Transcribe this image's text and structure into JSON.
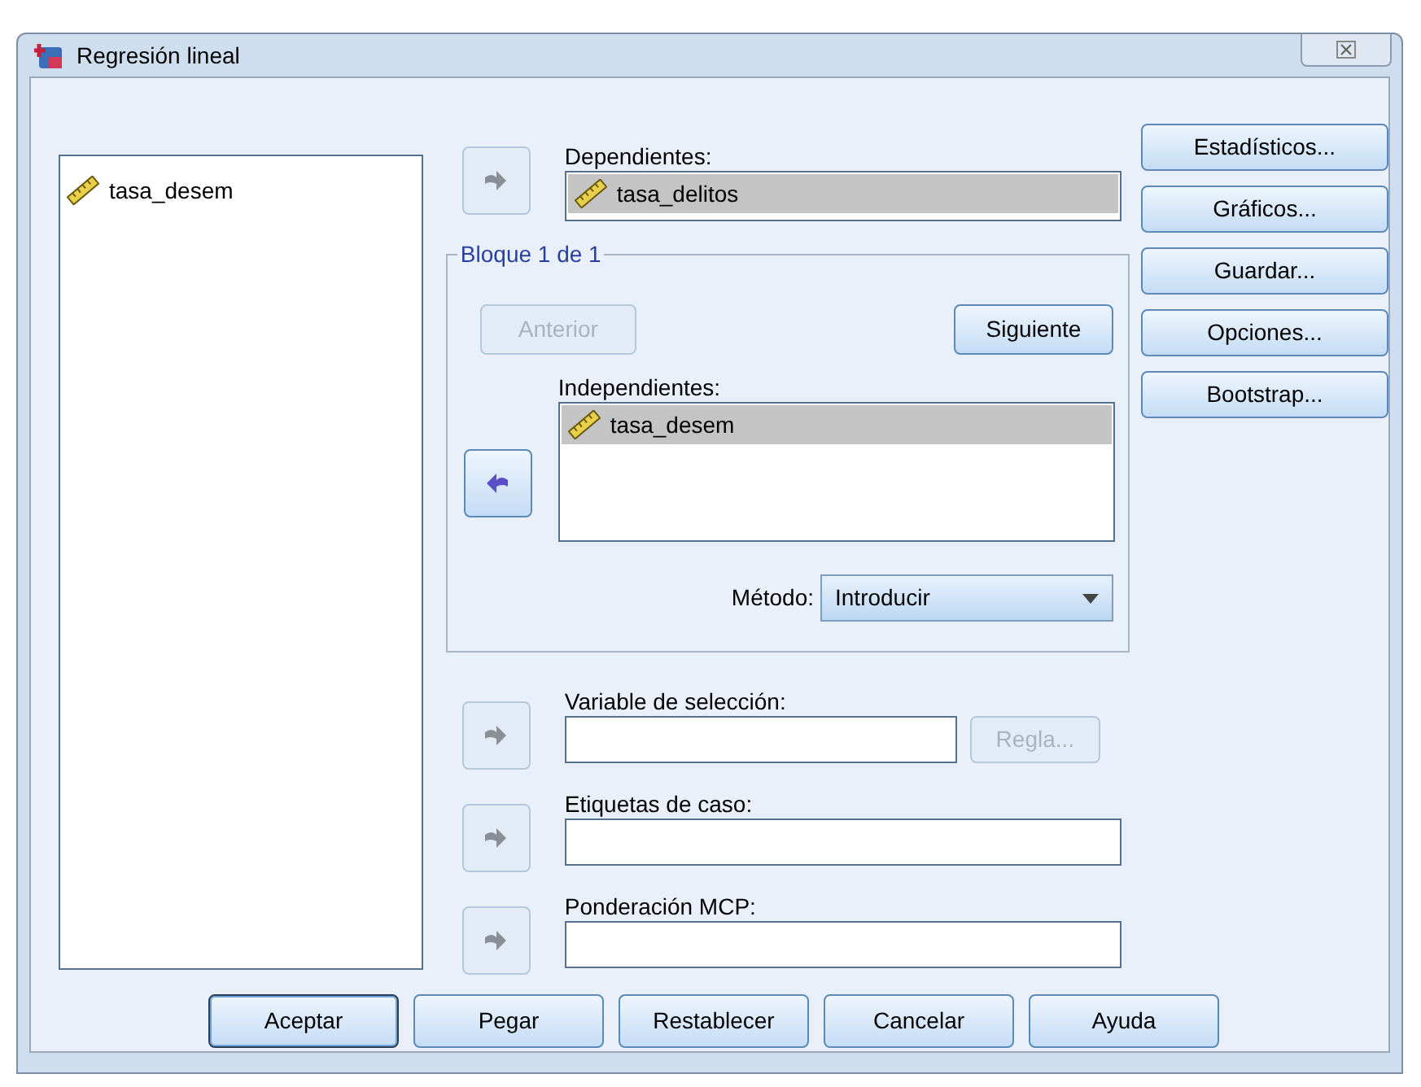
{
  "window": {
    "title": "Regresión lineal"
  },
  "variables": [
    {
      "name": "tasa_desem",
      "selected": false
    }
  ],
  "dependent": {
    "label": "Dependientes:",
    "arrow": {
      "kind": "right",
      "disabled": true
    },
    "items": [
      {
        "name": "tasa_delitos",
        "selected": true
      }
    ]
  },
  "block": {
    "title": "Bloque 1 de 1",
    "previous": {
      "label": "Anterior",
      "disabled": true
    },
    "next": {
      "label": "Siguiente",
      "disabled": false
    },
    "independent": {
      "label": "Independientes:",
      "arrow": {
        "kind": "left",
        "disabled": false
      },
      "items": [
        {
          "name": "tasa_desem",
          "selected": true
        }
      ]
    },
    "method": {
      "label": "Método:",
      "value": "Introducir"
    }
  },
  "selection": {
    "label": "Variable de selección:",
    "arrow": {
      "kind": "right",
      "disabled": true
    },
    "rule": {
      "label": "Regla...",
      "disabled": true
    }
  },
  "case_labels": {
    "label": "Etiquetas de caso:",
    "arrow": {
      "kind": "right",
      "disabled": true
    }
  },
  "wls_weight": {
    "label": "Ponderación MCP:",
    "arrow": {
      "kind": "right",
      "disabled": true
    }
  },
  "side_buttons": [
    "Estadísticos...",
    "Gráficos...",
    "Guardar...",
    "Opciones...",
    "Bootstrap..."
  ],
  "footer_buttons": [
    {
      "label": "Aceptar",
      "default": true
    },
    {
      "label": "Pegar",
      "default": false
    },
    {
      "label": "Restablecer",
      "default": false
    },
    {
      "label": "Cancelar",
      "default": false
    },
    {
      "label": "Ayuda",
      "default": false
    }
  ]
}
